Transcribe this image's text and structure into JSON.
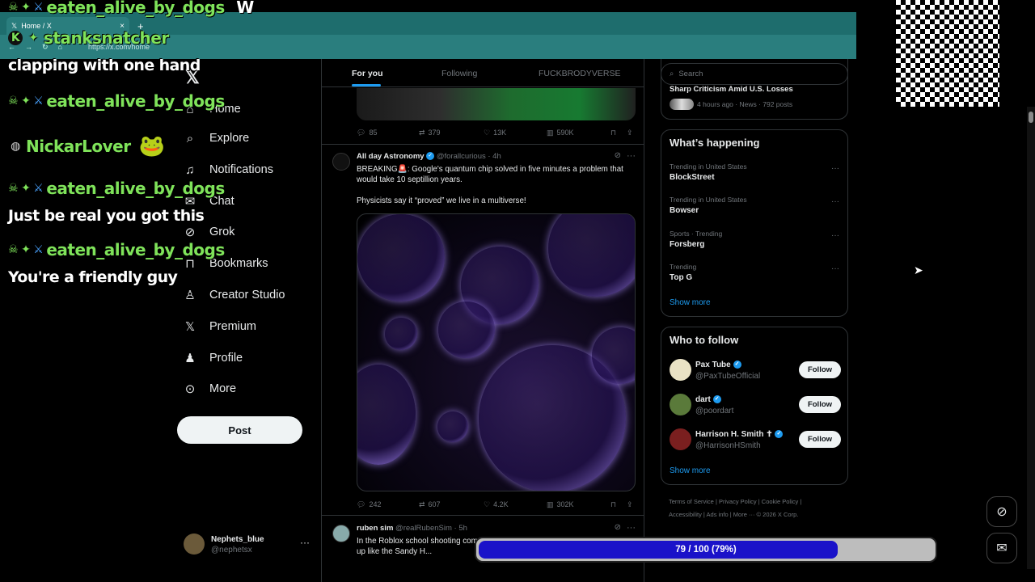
{
  "browser": {
    "tab_title": "Home / X",
    "url": "https://x.com/home"
  },
  "chat": [
    {
      "user": "eaten_alive_by_dogs",
      "text": "W"
    },
    {
      "user": "stanksnatcher",
      "text": "clapping with one hand"
    },
    {
      "user": "eaten_alive_by_dogs",
      "text": ""
    },
    {
      "user": "NickarLover",
      "text": ""
    },
    {
      "user": "eaten_alive_by_dogs",
      "text": "Just be real you got this"
    },
    {
      "user": "eaten_alive_by_dogs",
      "text": "You're a friendly guy"
    }
  ],
  "nav": {
    "items": [
      "Home",
      "Explore",
      "Notifications",
      "Chat",
      "Grok",
      "Bookmarks",
      "Creator Studio",
      "Premium",
      "Profile",
      "More"
    ],
    "post_label": "Post",
    "account": {
      "name": "Nephets_blue",
      "handle": "@nephetsx"
    }
  },
  "timeline": {
    "tabs": [
      "For you",
      "Following",
      "FUCKBRODYVERSE"
    ],
    "prev_post_actions": {
      "replies": "85",
      "reposts": "379",
      "likes": "13K",
      "views": "590K"
    },
    "post1": {
      "name": "All day Astronomy",
      "handle": "@forallcurious",
      "time": "· 4h",
      "text1": "BREAKING🚨: Google's quantum chip solved in five minutes a problem that would take 10 septillion years.",
      "text2": "Physicists say it “proved” we live in a multiverse!",
      "actions": {
        "replies": "242",
        "reposts": "607",
        "likes": "4.2K",
        "views": "302K"
      }
    },
    "post2": {
      "name": "ruben sim",
      "handle": "@realRubenSim",
      "time": "· 5h",
      "text": "In the Roblox school shooting com... their avatars up like the Sandy H..."
    }
  },
  "right": {
    "search_placeholder": "Search",
    "news": {
      "title": "Sharp Criticism Amid U.S. Losses",
      "meta": "4 hours ago · News · 792 posts"
    },
    "happening_title": "What’s happening",
    "trends": [
      {
        "meta": "Trending in United States",
        "topic": "BlockStreet"
      },
      {
        "meta": "Trending in United States",
        "topic": "Bowser"
      },
      {
        "meta": "Sports · Trending",
        "topic": "Forsberg"
      },
      {
        "meta": "Trending",
        "topic": "Top G"
      }
    ],
    "show_more": "Show more",
    "follow_title": "Who to follow",
    "follow": [
      {
        "name": "Pax Tube",
        "handle": "@PaxTubeOfficial"
      },
      {
        "name": "dart",
        "handle": "@poordart"
      },
      {
        "name": "Harrison H. Smith ✝",
        "handle": "@HarrisonHSmith"
      }
    ],
    "follow_label": "Follow",
    "footer": [
      "Terms of Service",
      "Privacy Policy",
      "Cookie Policy",
      "Accessibility",
      "Ads info",
      "More ···",
      "© 2026 X Corp."
    ]
  },
  "progress": {
    "label": "79 / 100 (79%)",
    "fraction": 0.79
  }
}
